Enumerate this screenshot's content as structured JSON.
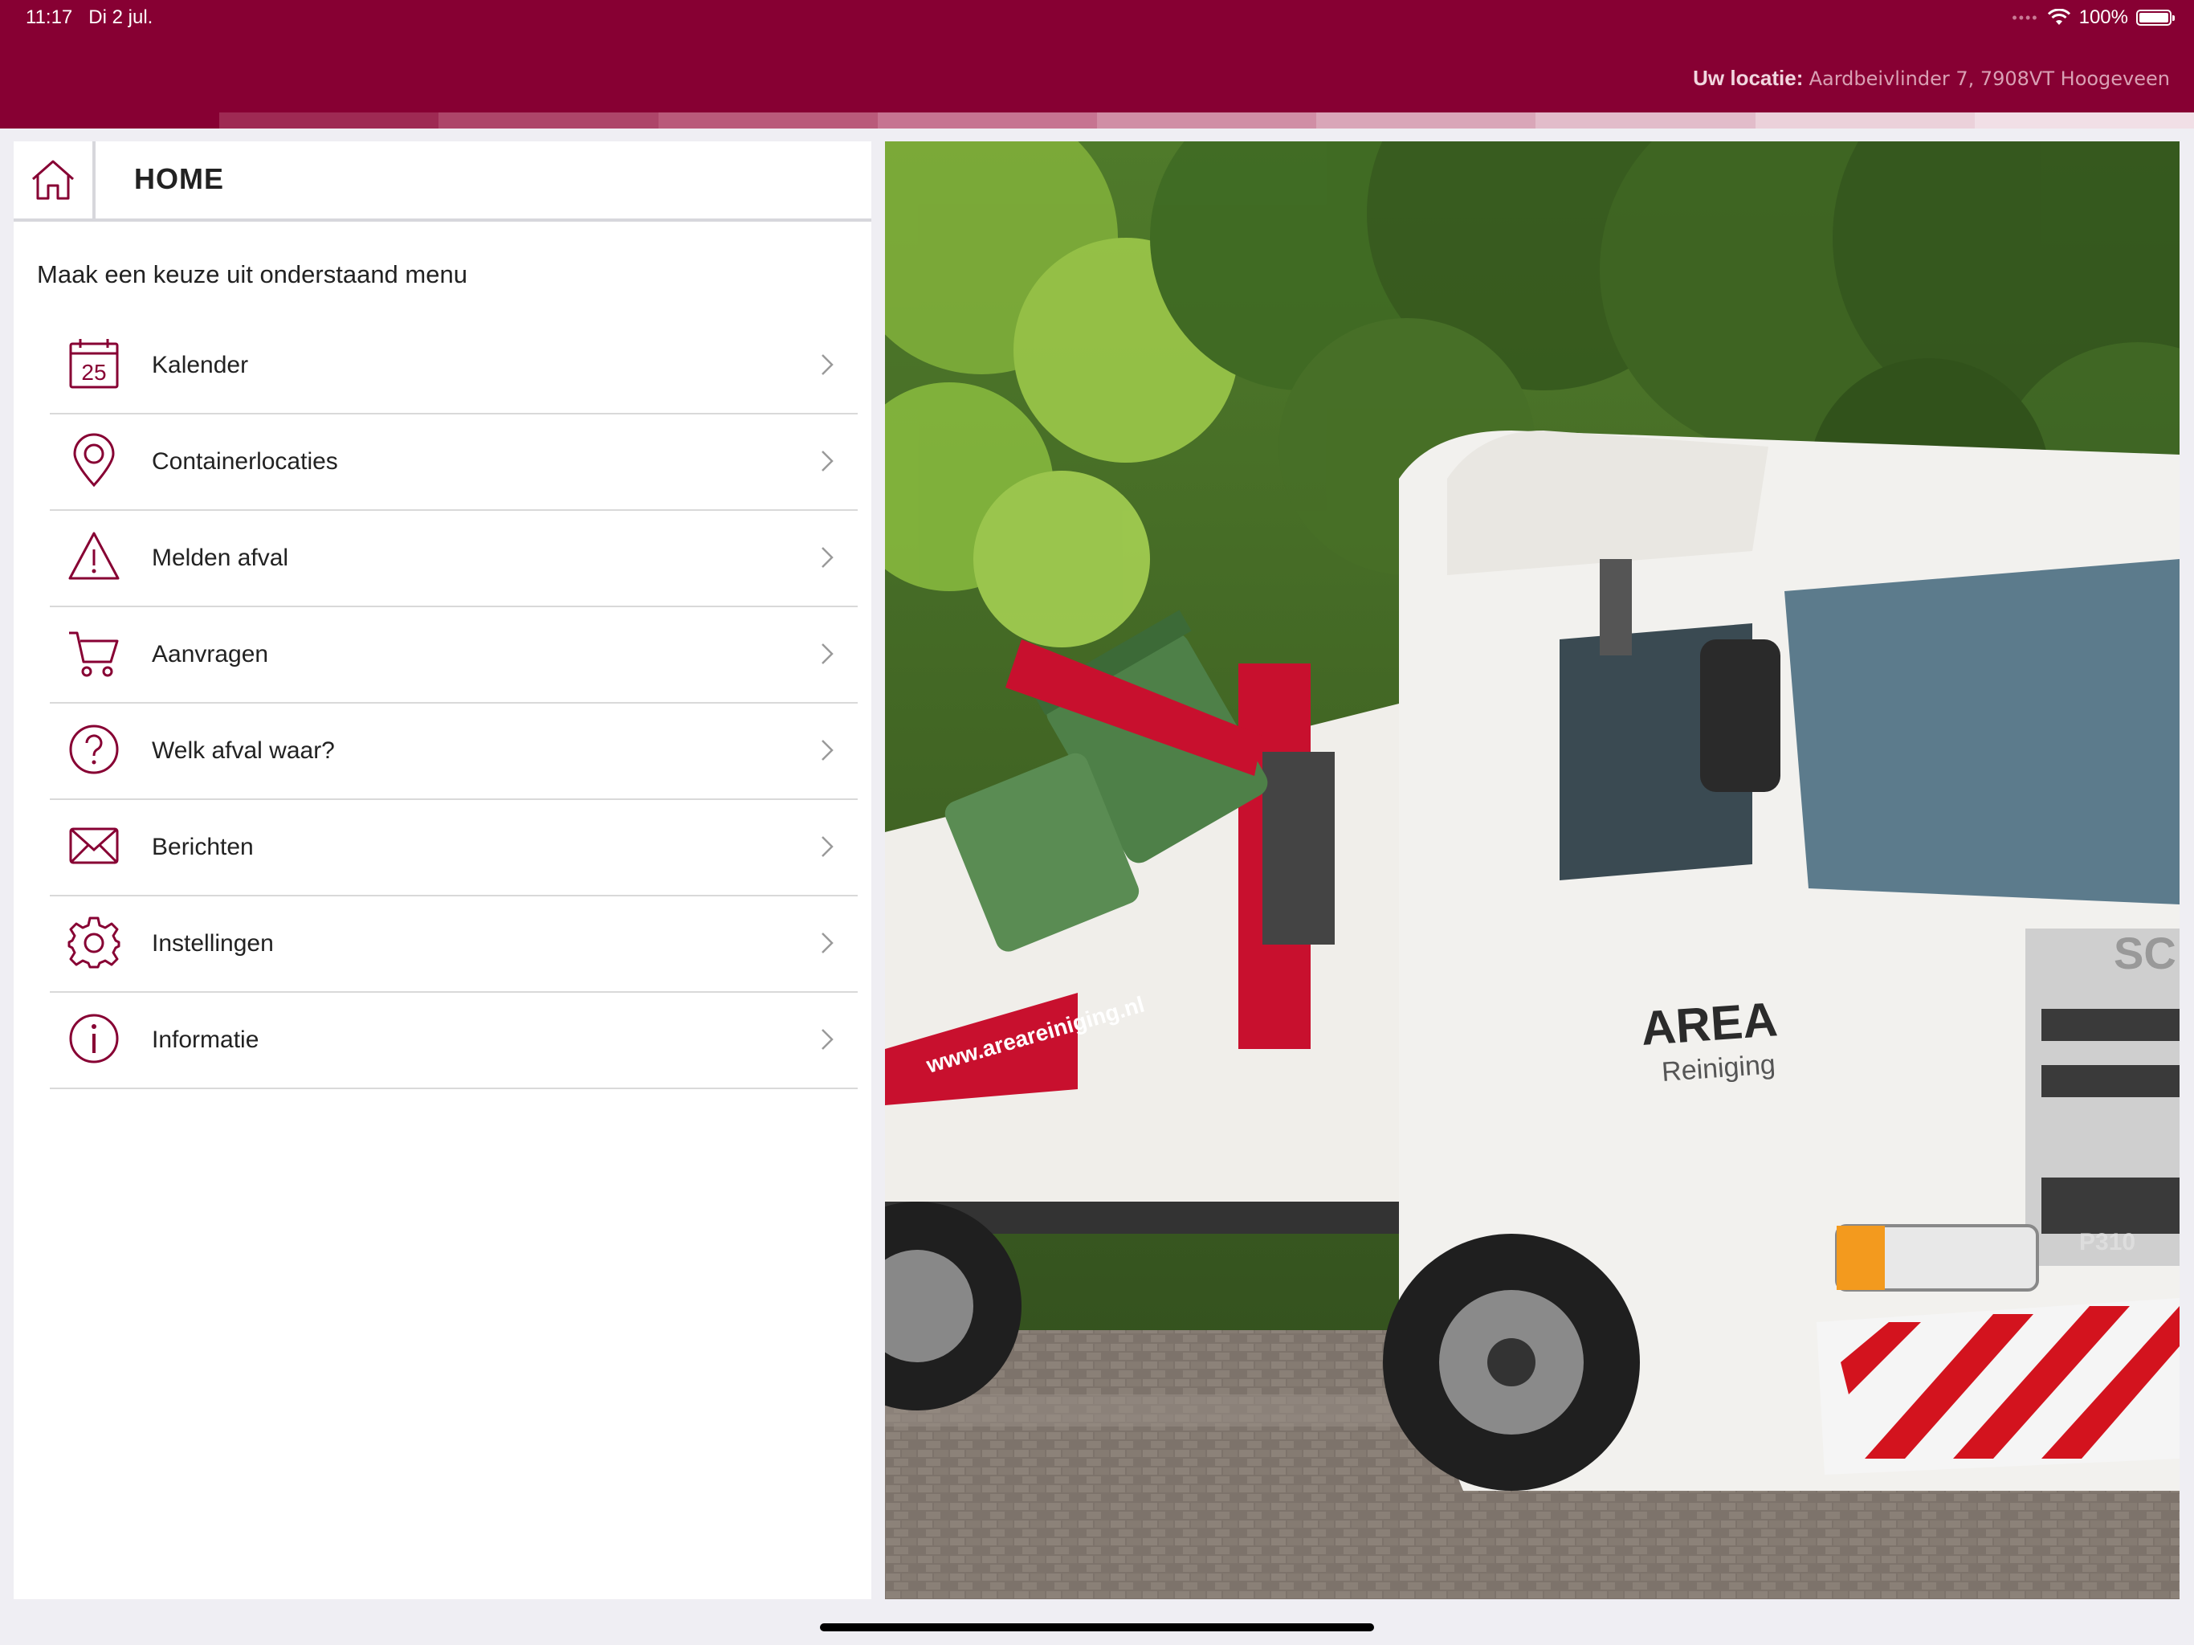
{
  "status_bar": {
    "time": "11:17",
    "date": "Di 2 jul.",
    "battery": "100%",
    "signal": "••••"
  },
  "header": {
    "location_label": "Uw locatie:",
    "location_value": "Aardbeivlinder 7, 7908VT Hoogeveen",
    "brand_color": "#870033"
  },
  "stripe_colors": [
    "#870033",
    "#9e2a53",
    "#ad4569",
    "#b95a7a",
    "#c67491",
    "#d08ea5",
    "#d9a6b8",
    "#e2bcca",
    "#ebd1da",
    "#f1dfe6"
  ],
  "panel": {
    "title": "HOME",
    "intro": "Maak een keuze uit onderstaand menu"
  },
  "menu": {
    "items": [
      {
        "label": "Kalender",
        "icon": "calendar-icon",
        "day": "25"
      },
      {
        "label": "Containerlocaties",
        "icon": "location-pin-icon"
      },
      {
        "label": "Melden afval",
        "icon": "warning-icon"
      },
      {
        "label": "Aanvragen",
        "icon": "cart-icon"
      },
      {
        "label": "Welk afval waar?",
        "icon": "question-icon"
      },
      {
        "label": "Berichten",
        "icon": "mail-icon"
      },
      {
        "label": "Instellingen",
        "icon": "gear-icon"
      },
      {
        "label": "Informatie",
        "icon": "info-icon"
      }
    ]
  },
  "photo": {
    "brand": "AREA",
    "brand_sub": "Reiniging",
    "website": "www.areareiniging.nl",
    "model": "P310",
    "grille": "SC"
  }
}
